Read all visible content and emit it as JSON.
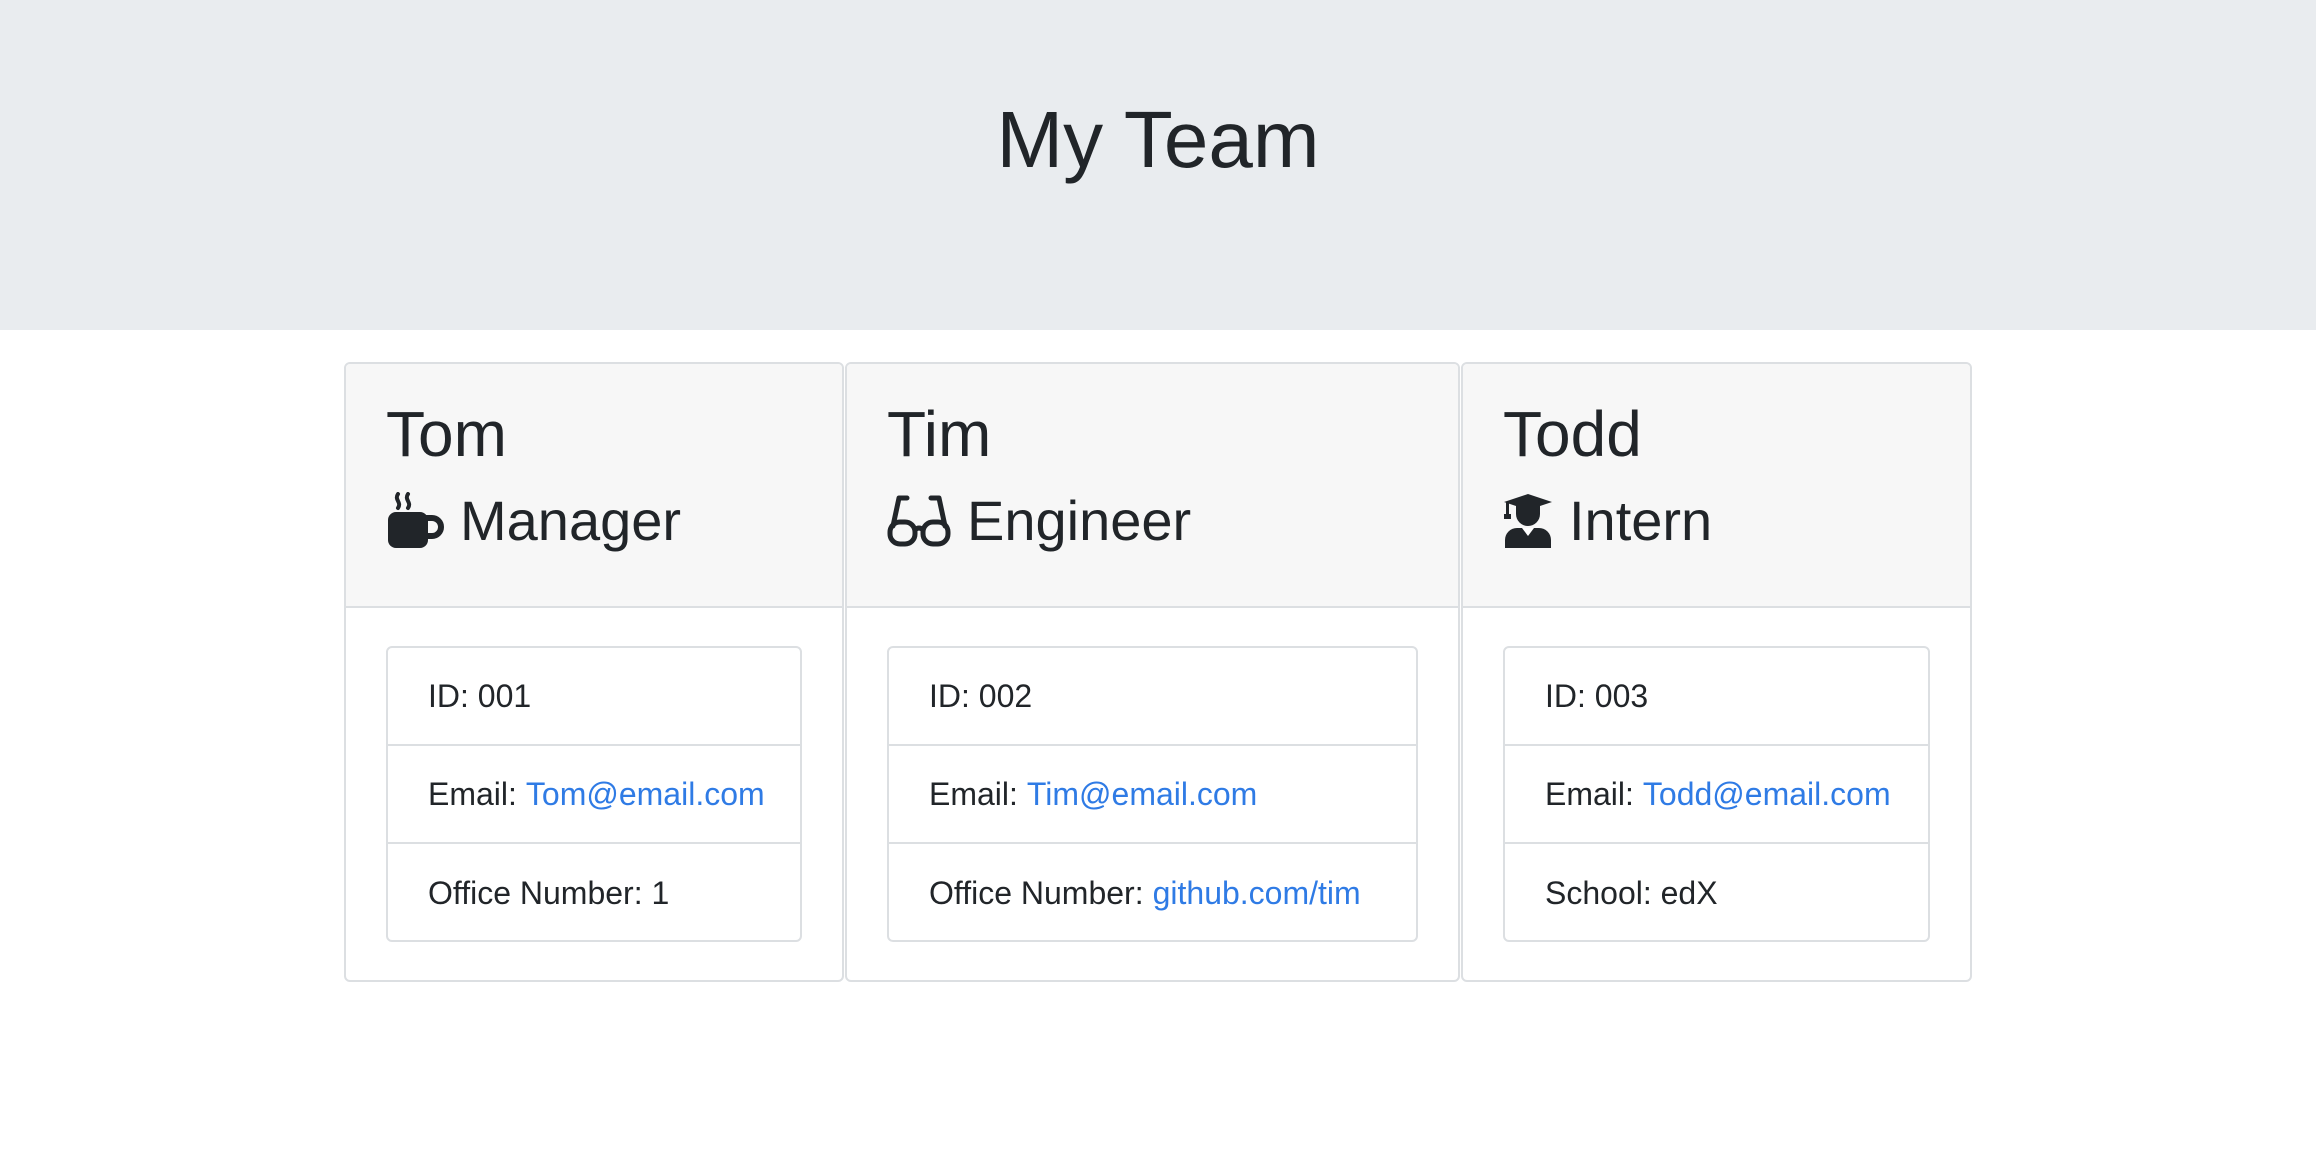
{
  "header": {
    "title": "My Team"
  },
  "employees": [
    {
      "name": "Tom",
      "role": "Manager",
      "icon": "coffee-mug-icon",
      "id_label": "ID: 001",
      "email_label": "Email:",
      "email": "Tom@email.com",
      "extra_label": "Office Number: 1",
      "extra_link": ""
    },
    {
      "name": "Tim",
      "role": "Engineer",
      "icon": "glasses-icon",
      "id_label": "ID: 002",
      "email_label": "Email:",
      "email": "Tim@email.com",
      "extra_label": "Office Number:",
      "extra_link": "github.com/tim"
    },
    {
      "name": "Todd",
      "role": "Intern",
      "icon": "graduate-icon",
      "id_label": "ID: 003",
      "email_label": "Email:",
      "email": "Todd@email.com",
      "extra_label": "School: edX",
      "extra_link": ""
    }
  ],
  "colors": {
    "header_bg": "#e9ecef",
    "card_header_bg": "#f7f7f7",
    "link": "#2f7be5",
    "text": "#212529"
  }
}
